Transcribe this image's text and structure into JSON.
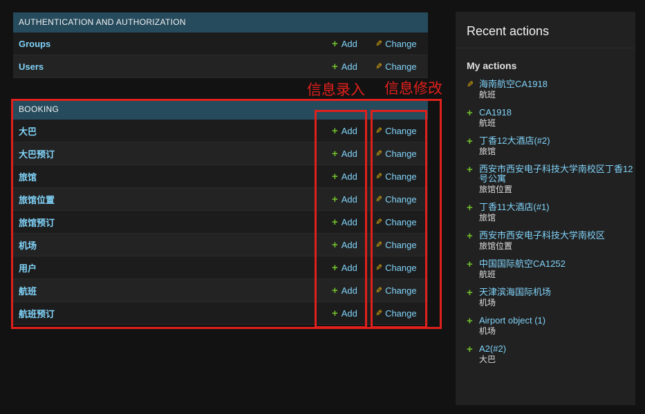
{
  "modules": [
    {
      "header": "AUTHENTICATION AND AUTHORIZATION",
      "rows": [
        {
          "name": "Groups",
          "add": "Add",
          "change": "Change"
        },
        {
          "name": "Users",
          "add": "Add",
          "change": "Change"
        }
      ]
    },
    {
      "header": "BOOKING",
      "rows": [
        {
          "name": "大巴",
          "add": "Add",
          "change": "Change"
        },
        {
          "name": "大巴预订",
          "add": "Add",
          "change": "Change"
        },
        {
          "name": "旅馆",
          "add": "Add",
          "change": "Change"
        },
        {
          "name": "旅馆位置",
          "add": "Add",
          "change": "Change"
        },
        {
          "name": "旅馆预订",
          "add": "Add",
          "change": "Change"
        },
        {
          "name": "机场",
          "add": "Add",
          "change": "Change"
        },
        {
          "name": "用户",
          "add": "Add",
          "change": "Change"
        },
        {
          "name": "航班",
          "add": "Add",
          "change": "Change"
        },
        {
          "name": "航班预订",
          "add": "Add",
          "change": "Change"
        }
      ]
    }
  ],
  "recent_actions": {
    "title": "Recent actions",
    "subtitle": "My actions",
    "items": [
      {
        "icon": "pencil-icon",
        "label": "海南航空CA1918",
        "type": "航班"
      },
      {
        "icon": "plus-icon",
        "label": "CA1918",
        "type": "航班"
      },
      {
        "icon": "plus-icon",
        "label": "丁香12大酒店(#2)",
        "type": "旅馆"
      },
      {
        "icon": "plus-icon",
        "label": "西安市西安电子科技大学南校区丁香12号公寓",
        "type": "旅馆位置"
      },
      {
        "icon": "plus-icon",
        "label": "丁香11大酒店(#1)",
        "type": "旅馆"
      },
      {
        "icon": "plus-icon",
        "label": "西安市西安电子科技大学南校区",
        "type": "旅馆位置"
      },
      {
        "icon": "plus-icon",
        "label": "中国国际航空CA1252",
        "type": "航班"
      },
      {
        "icon": "plus-icon",
        "label": "天津滨海国际机场",
        "type": "机场"
      },
      {
        "icon": "plus-icon",
        "label": "Airport object (1)",
        "type": "机场"
      },
      {
        "icon": "plus-icon",
        "label": "A2(#2)",
        "type": "大巴"
      }
    ]
  },
  "annotations": {
    "add_label": "信息录入",
    "change_label": "信息修改",
    "color": "#e0201c"
  },
  "colors": {
    "module_header_bg": "#264b5d",
    "link": "#81d4fa",
    "add_icon": "#70bf2b",
    "change_icon": "#efb80b",
    "background": "#121212"
  }
}
